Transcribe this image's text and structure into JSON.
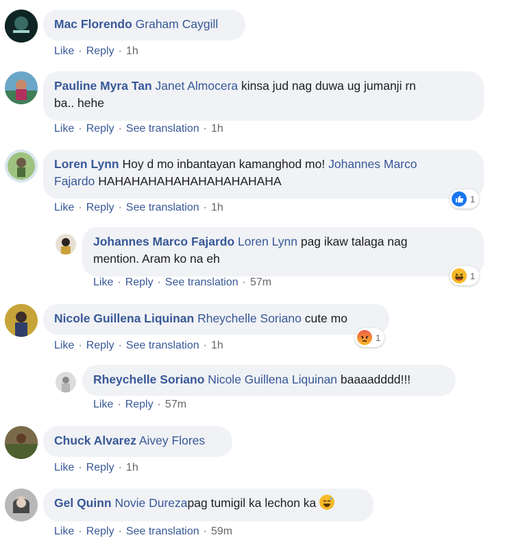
{
  "comments": [
    {
      "author": "Mac Florendo",
      "mention": "Graham Caygill",
      "text": "",
      "actions": {
        "like": "Like",
        "reply": "Reply",
        "time": "1h"
      }
    },
    {
      "author": "Pauline Myra Tan",
      "mention": "Janet Almocera",
      "text_line1": " kinsa jud nag duwa ug jumanji rn",
      "text_line2": "ba.. hehe",
      "actions": {
        "like": "Like",
        "reply": "Reply",
        "translate": "See translation",
        "time": "1h"
      }
    },
    {
      "author": "Loren Lynn",
      "text_line1_a": " Hoy d mo inbantayan kamanghod mo! ",
      "mention_a": "Johannes Marco",
      "mention_b": "Fajardo",
      "text_line2_b": " HAHAHAHAHAHAHAHAHAHAHA",
      "actions": {
        "like": "Like",
        "reply": "Reply",
        "translate": "See translation",
        "time": "1h"
      },
      "reaction_count": "1",
      "reaction_type": "like-reaction-icon"
    },
    {
      "author": "Johannes Marco Fajardo",
      "mention": "Loren Lynn",
      "text_line1": " pag ikaw talaga nag",
      "text_line2": "mention. Aram ko na eh",
      "actions": {
        "like": "Like",
        "reply": "Reply",
        "translate": "See translation",
        "time": "57m"
      },
      "reaction_count": "1",
      "reaction_type": "haha-reaction-icon"
    },
    {
      "author": "Nicole Guillena Liquinan",
      "mention": "Rheychelle Soriano",
      "text": " cute mo",
      "actions": {
        "like": "Like",
        "reply": "Reply",
        "translate": "See translation",
        "time": "1h"
      },
      "reaction_count": "1",
      "reaction_type": "angry-reaction-icon"
    },
    {
      "author": "Rheychelle Soriano",
      "mention": "Nicole Guillena Liquinan",
      "text": " baaaadddd!!!",
      "actions": {
        "like": "Like",
        "reply": "Reply",
        "time": "57m"
      }
    },
    {
      "author": "Chuck Alvarez",
      "mention": "Aivey Flores",
      "text": "",
      "actions": {
        "like": "Like",
        "reply": "Reply",
        "time": "1h"
      }
    },
    {
      "author": "Gel Quinn",
      "mention": "Novie Dureza",
      "text": "pag tumigil ka lechon ka",
      "emoji": "sweat-smile-emoji",
      "actions": {
        "like": "Like",
        "reply": "Reply",
        "translate": "See translation",
        "time": "59m"
      }
    }
  ],
  "separator": "·",
  "colors": {
    "link": "#385898",
    "bubble": "#f0f2f5",
    "meta": "#65676b"
  }
}
